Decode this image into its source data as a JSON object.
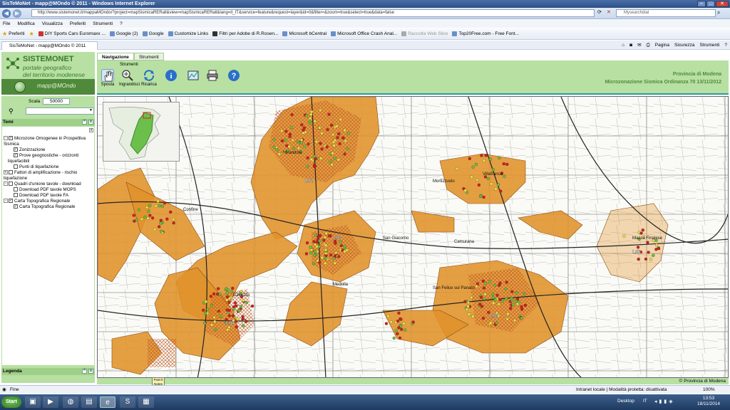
{
  "window": {
    "title": "SisTeMoNet - mapp@MOndo © 2011 - Windows Internet Explorer"
  },
  "browser": {
    "url": "http://www.sistemonet.it/mappaMOndo/?project=mapSismicaRERall&view=mapSismicaRERall&lang=it_IT&service=feature&request=layer&id=0&filter=&zoom=true&select=true&data=false",
    "search_placeholder": "Mysearchdial",
    "menu": [
      "File",
      "Modifica",
      "Visualizza",
      "Preferiti",
      "Strumenti",
      "?"
    ],
    "favorites_label": "Preferiti",
    "favorites": [
      {
        "label": "DIY Sports Cars Euromaxx ...",
        "dim": false
      },
      {
        "label": "Google (2)",
        "dim": false
      },
      {
        "label": "Google",
        "dim": false
      },
      {
        "label": "Customize Links",
        "dim": false
      },
      {
        "label": "Filtri per Adobe di R.Rosen...",
        "dim": false
      },
      {
        "label": "Microsoft bCentral",
        "dim": false
      },
      {
        "label": "Microsoft Office Crash Anal...",
        "dim": false
      },
      {
        "label": "Raccolta Web Slice",
        "dim": true
      },
      {
        "label": "Top20Free.com - Free Font...",
        "dim": false
      }
    ],
    "tab_title": "SisTeMoNet - mapp@MOndo © 2011",
    "command_bar": [
      "Pagina",
      "Sicurezza",
      "Strumenti"
    ]
  },
  "header": {
    "brand_title": "SISTEMONET",
    "brand_sub1": "portale geografico",
    "brand_sub2": "del territorio modenese",
    "app_name": "mapp@MOndo",
    "tabs": [
      "Navigazione",
      "Strumenti"
    ],
    "tool_group_label": "Strumenti",
    "tools": [
      {
        "label": "Sposta",
        "icon": "hand-icon"
      },
      {
        "label": "Ingrandisci",
        "icon": "zoom-in-icon"
      },
      {
        "label": "Ricarica",
        "icon": "refresh-icon"
      },
      {
        "label": "",
        "icon": "info-icon"
      },
      {
        "label": "",
        "icon": "map-link-icon"
      },
      {
        "label": "",
        "icon": "print-icon"
      },
      {
        "label": "",
        "icon": "help-icon"
      }
    ],
    "province": "Provincia di Modena",
    "project": "Microzonazione Sismica Ordinanza 70 13/11/2012"
  },
  "sidebar": {
    "scale_label": "Scala",
    "scale_value": "50000",
    "temi_title": "Temi",
    "tree": [
      {
        "label": "Microzone Omogenee in Prospettiva Sismica",
        "level": 0,
        "expander": "-",
        "checked": true
      },
      {
        "label": "Zonizzazione",
        "level": 1,
        "expander": "",
        "checked": true
      },
      {
        "label": "Prove geognostiche - orizzonti liquefacibili",
        "level": 1,
        "expander": "",
        "checked": true
      },
      {
        "label": "Punti di liquefazione",
        "level": 1,
        "expander": "",
        "checked": false
      },
      {
        "label": "Fattori di amplificazione - rischio liquefazione",
        "level": 0,
        "expander": "+",
        "checked": false
      },
      {
        "label": "Quadri d'unione tavole - download",
        "level": 0,
        "expander": "-",
        "checked": false
      },
      {
        "label": "Download PDF tavole MOPS",
        "level": 1,
        "expander": "",
        "checked": false
      },
      {
        "label": "Download PDF tavole FA",
        "level": 1,
        "expander": "",
        "checked": false
      },
      {
        "label": "Carta Topografica Regionale",
        "level": 0,
        "expander": "-",
        "checked": true
      },
      {
        "label": "Carta Topografica Regionale",
        "level": 1,
        "expander": "",
        "checked": true
      }
    ],
    "legenda_title": "Legenda"
  },
  "map": {
    "copyright": "© Provincia di Modena",
    "labels": [
      "Cavezzo",
      "Medolla",
      "Mirandola",
      "San Felice sul Panaro",
      "Massa Finalese",
      "Mortizzuolo",
      "Camurana",
      "Villafranca",
      "San Giacomo",
      "Confine"
    ],
    "zone_labels": [
      "L02",
      "L03",
      "L04",
      "L05",
      "L01"
    ],
    "colors": {
      "zone": "#e0922a",
      "hatch": "#c96a18",
      "red_dot": "#d01f1f",
      "yellow_dot": "#f0e040",
      "green_dot": "#6bbf3a"
    }
  },
  "post_it": {
    "line1": "Post-it",
    "line2": "Notes"
  },
  "status": {
    "left": "Fine",
    "zone": "Intranet locale | Modalità protetta: disattivata",
    "zoom": "100%"
  },
  "taskbar": {
    "start": "Start",
    "desktop": "Desktop",
    "lang": "IT",
    "time": "13:53",
    "date": "18/11/2014"
  }
}
